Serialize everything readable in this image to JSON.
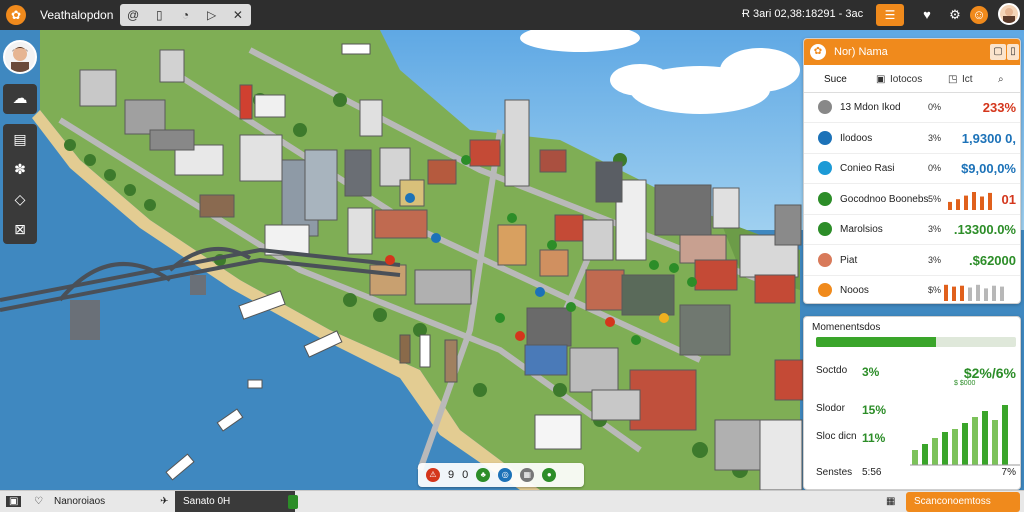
{
  "topbar": {
    "app_title": "Veathalopdon",
    "tools": [
      "@",
      "▯",
      "◔",
      "▷",
      "✕"
    ],
    "clock": "Ɍ 3ari 02,38:18291 - 3ac",
    "orange_button_icon": "list-icon"
  },
  "left_toolbar": {
    "top_button_icon": "cloud-icon",
    "group_icons": [
      "document-icon",
      "paw-icon",
      "cloud-outline-icon",
      "crossed-flag-icon"
    ]
  },
  "stats_panel": {
    "title": "Nor) Nama",
    "tabs": [
      "Suce",
      "Iotocos",
      "Ict"
    ],
    "rows": [
      {
        "label": "13 Mdon Ikod",
        "pct": "0%",
        "value": "233%",
        "color": "#d4361c",
        "icon_color": "#888888",
        "icon": "hash-icon"
      },
      {
        "label": "Ilodoos",
        "pct": "3%",
        "value": "1,9300 0,",
        "color": "#1c72b8",
        "icon_color": "#1c72b8",
        "icon": "globe-icon"
      },
      {
        "label": "Conieo Rasi",
        "pct": "0%",
        "value": "$9,00,0%",
        "color": "#1c72b8",
        "icon_color": "#1c9ad6",
        "icon": "gear-icon"
      },
      {
        "label": "Gocodnoo Boonebs",
        "pct": "5%",
        "value": "01",
        "color": "#d4361c",
        "icon_color": "#2c8d28",
        "icon": "leaf-icon"
      },
      {
        "label": "Marolsios",
        "pct": "3%",
        "value": ".13300.0%",
        "color": "#2c8d28",
        "icon_color": "#2c8d28",
        "icon": "leaf-icon"
      },
      {
        "label": "Piat",
        "pct": "3%",
        "value": ".$62000",
        "color": "#2c8d28",
        "icon_color": "#d87a5a",
        "icon": "circle-icon"
      },
      {
        "label": "Nooos",
        "pct": "$%",
        "value": "",
        "color": "#888888",
        "icon_color": "#f08a1c",
        "icon": "coin-icon"
      }
    ],
    "spark_growth": [
      0.45,
      0.6,
      0.8,
      1.0,
      0.75,
      0.95
    ],
    "spark_pressure": [
      0.9,
      0.8,
      0.85,
      0.75,
      0.9,
      0.7,
      0.85,
      0.8
    ]
  },
  "management_panel": {
    "title": "Momenentsdos",
    "progress": 0.6,
    "rows": [
      {
        "label": "Soctdo",
        "pct": "3%",
        "value": "$2%/6%",
        "sub": "$ $000"
      },
      {
        "label": "Slodor",
        "pct": "15%",
        "value": "",
        "sub": ""
      },
      {
        "label": "Sloc dicn",
        "pct": "11%",
        "value": "",
        "sub": ""
      },
      {
        "label": "Senstes",
        "pct": "5:56",
        "value": "7%",
        "sub": ""
      }
    ],
    "bars": [
      0.25,
      0.35,
      0.45,
      0.55,
      0.6,
      0.7,
      0.8,
      0.9,
      0.75,
      1.0
    ]
  },
  "zoombar": {
    "items": [
      "9",
      "0"
    ]
  },
  "bottombar": {
    "left_label": "Nanoroiaos",
    "dark_label": "Sanato 0H",
    "orange_label": "Scanconoemtoss"
  },
  "colors": {
    "accent": "#f08a1c",
    "green": "#2c8d28",
    "water": "#4a8fc4"
  }
}
